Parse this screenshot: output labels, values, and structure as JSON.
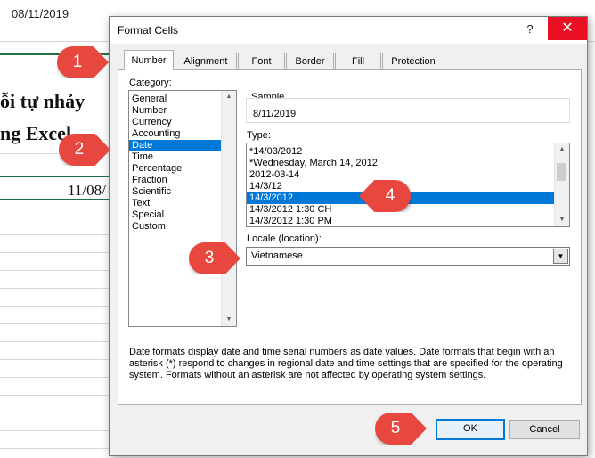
{
  "excel": {
    "formula_value": "08/11/2019",
    "text_line1": "ỗi tự nhảy",
    "text_line2": "ng Excel",
    "cell_value": "11/08/"
  },
  "dialog": {
    "title": "Format Cells",
    "help": "?",
    "close": "✕",
    "tabs": [
      "Number",
      "Alignment",
      "Font",
      "Border",
      "Fill",
      "Protection"
    ],
    "active_tab": "Number",
    "category_label": "Category:",
    "categories": [
      "General",
      "Number",
      "Currency",
      "Accounting",
      "Date",
      "Time",
      "Percentage",
      "Fraction",
      "Scientific",
      "Text",
      "Special",
      "Custom"
    ],
    "selected_category": "Date",
    "sample_label": "Sample",
    "sample_value": "8/11/2019",
    "type_label": "Type:",
    "types": [
      "*14/03/2012",
      "*Wednesday, March 14, 2012",
      "2012-03-14",
      "14/3/12",
      "14/3/2012",
      "14/3/2012 1:30 CH",
      "14/3/2012 1:30 PM"
    ],
    "selected_type": "14/3/2012",
    "locale_label": "Locale (location):",
    "locale_value": "Vietnamese",
    "description": "Date formats display date and time serial numbers as date values.  Date formats that begin with an asterisk (*) respond to changes in regional date and time settings that are specified for the operating system. Formats without an asterisk are not affected by operating system settings.",
    "ok_label": "OK",
    "cancel_label": "Cancel"
  },
  "callouts": [
    "1",
    "2",
    "3",
    "4",
    "5"
  ],
  "colors": {
    "callout": "#e8473f",
    "selection": "#0078d7",
    "close": "#e81123"
  }
}
